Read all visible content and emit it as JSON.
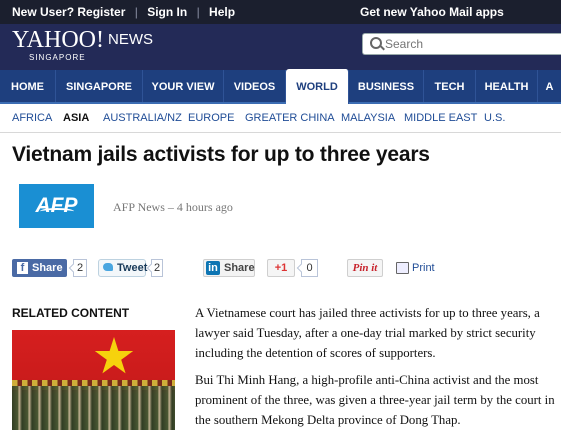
{
  "topbar": {
    "new_user": "New User?",
    "register": "Register",
    "sign_in": "Sign In",
    "help": "Help",
    "mail_promo": "Get new Yahoo Mail apps"
  },
  "header": {
    "logo": "YAHOO!",
    "logo_news": "NEWS",
    "logo_region": "SINGAPORE",
    "search_placeholder": "Search"
  },
  "nav": {
    "items": [
      {
        "label": "HOME"
      },
      {
        "label": "SINGAPORE"
      },
      {
        "label": "YOUR VIEW"
      },
      {
        "label": "VIDEOS"
      },
      {
        "label": "WORLD"
      },
      {
        "label": "BUSINESS"
      },
      {
        "label": "TECH"
      },
      {
        "label": "HEALTH"
      },
      {
        "label": "A"
      }
    ],
    "active": "WORLD"
  },
  "subnav": {
    "items": [
      {
        "label": "AFRICA"
      },
      {
        "label": "ASIA"
      },
      {
        "label": "AUSTRALIA/NZ"
      },
      {
        "label": "EUROPE"
      },
      {
        "label": "GREATER CHINA"
      },
      {
        "label": "MALAYSIA"
      },
      {
        "label": "MIDDLE EAST"
      },
      {
        "label": "U.S."
      }
    ],
    "active": "ASIA"
  },
  "article": {
    "headline": "Vietnam jails activists for up to three years",
    "source_logo": "AFP",
    "byline": "AFP News – 4 hours ago",
    "paragraphs": [
      "A Vietnamese court has jailed three activists for up to three years, a lawyer said Tuesday, after a one-day trial marked by strict security including the detention of scores of supporters.",
      "Bui Thi Minh Hang, a high-profile anti-China activist and the most prominent of the three, was given a three-year jail term by the court in the southern Mekong Delta province of Dong Thap."
    ]
  },
  "share": {
    "facebook_label": "Share",
    "facebook_count": "2",
    "tweet_label": "Tweet",
    "tweet_count": "2",
    "linkedin_label": "Share",
    "gplus_label": "+1",
    "gplus_count": "0",
    "pinterest_label": "Pin it",
    "print_label": "Print"
  },
  "related": {
    "title": "RELATED CONTENT"
  },
  "colors": {
    "topbar_bg": "#1b1f2e",
    "header_bg": "#232a57",
    "nav_bg": "#1e3f7e",
    "link": "#1f4c96",
    "afp_blue": "#1a8fd3"
  }
}
